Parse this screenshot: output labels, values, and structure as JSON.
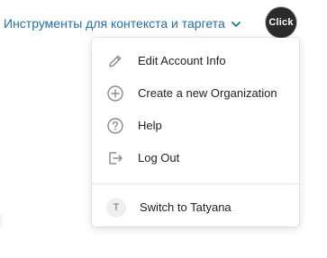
{
  "header": {
    "tools_link_label": "Инструменты для контекста и таргета",
    "avatar_text": "Click"
  },
  "menu": {
    "items": [
      {
        "label": "Edit Account Info",
        "icon": "pencil-icon"
      },
      {
        "label": "Create a new Organization",
        "icon": "plus-circle-icon"
      },
      {
        "label": "Help",
        "icon": "question-circle-icon"
      },
      {
        "label": "Log Out",
        "icon": "logout-icon"
      }
    ],
    "switch_item": {
      "initial": "T",
      "label": "Switch to Tatyana"
    }
  },
  "colors": {
    "link": "#1d6fb8",
    "text": "#1f1f1f",
    "icon": "#8a8a8a"
  }
}
